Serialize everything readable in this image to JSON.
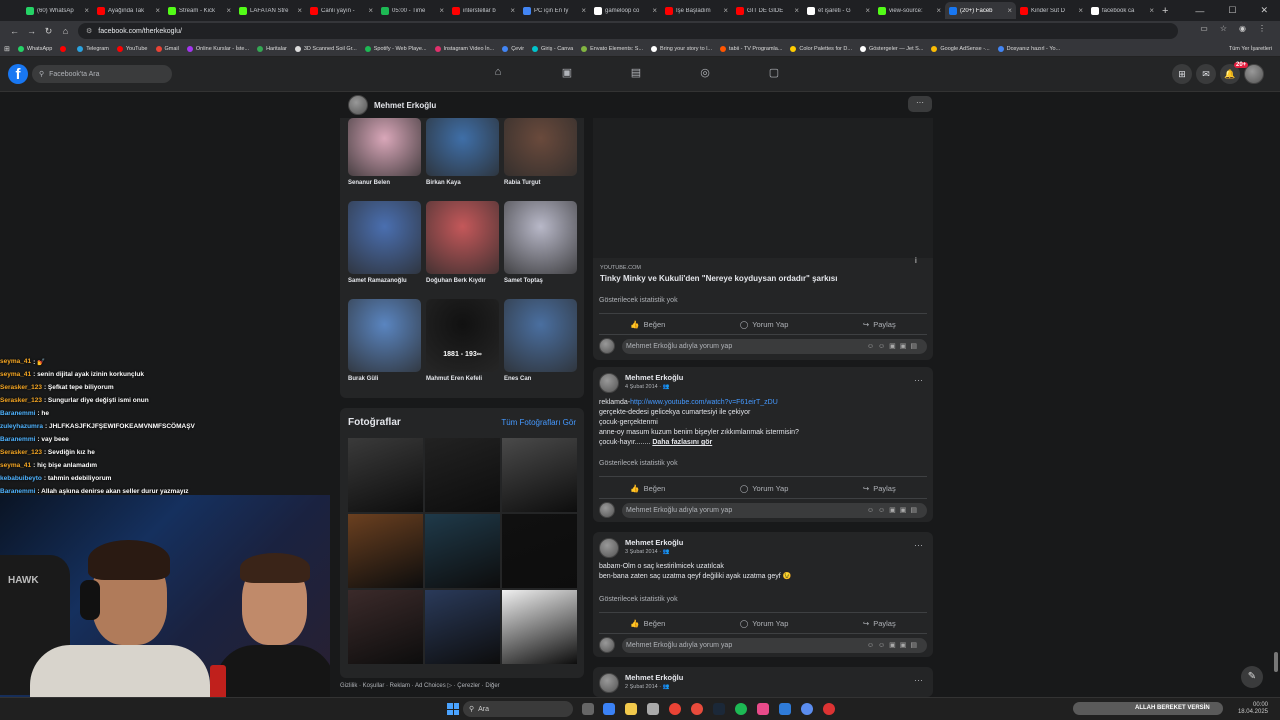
{
  "browser": {
    "tabs": [
      {
        "title": "(60) WhatsAp",
        "color": "#25d366"
      },
      {
        "title": "Ayağında Tak",
        "color": "#ff0000"
      },
      {
        "title": "Stream - Kick",
        "color": "#53fc18"
      },
      {
        "title": "LAFATAN Stre",
        "color": "#53fc18"
      },
      {
        "title": "Canlı yayın -",
        "color": "#ff0000"
      },
      {
        "title": "05:00 - Time",
        "color": "#1db954"
      },
      {
        "title": "interstellar b",
        "color": "#ff0000"
      },
      {
        "title": "PC için En İy",
        "color": "#4285f4"
      },
      {
        "title": "gameloop co",
        "color": "#ffffff"
      },
      {
        "title": "İşe Başladım",
        "color": "#ff0000"
      },
      {
        "title": "GİT DE GİDE",
        "color": "#ff0000"
      },
      {
        "title": "et işareti - G",
        "color": "#ffffff"
      },
      {
        "title": "view-source:",
        "color": "#53fc18"
      },
      {
        "title": "(20+) Faceb",
        "color": "#1877f2",
        "active": true
      },
      {
        "title": "Kinder Süt D",
        "color": "#ff0000"
      },
      {
        "title": "facebook ca",
        "color": "#ffffff"
      }
    ],
    "url": "facebook.com/therkekoglu/",
    "bookmarks": [
      {
        "label": "WhatsApp",
        "color": "#25d366"
      },
      {
        "label": "",
        "color": "#ff0000"
      },
      {
        "label": "Telegram",
        "color": "#2aa3e0"
      },
      {
        "label": "YouTube",
        "color": "#ff0000"
      },
      {
        "label": "Gmail",
        "color": "#ea4335"
      },
      {
        "label": "Online Kurslar - İste...",
        "color": "#a435f0"
      },
      {
        "label": "Haritalar",
        "color": "#34a853"
      },
      {
        "label": "3D Scanned Soil Gr...",
        "color": "#dddddd"
      },
      {
        "label": "Spotify - Web Playe...",
        "color": "#1db954"
      },
      {
        "label": "Instagram Video İn...",
        "color": "#e1306c"
      },
      {
        "label": "Çevir",
        "color": "#4285f4"
      },
      {
        "label": "Giriş - Canva",
        "color": "#00c4cc"
      },
      {
        "label": "Envato Elements: S...",
        "color": "#82b541"
      },
      {
        "label": "Bring your story to l...",
        "color": "#ffffff"
      },
      {
        "label": "tabii - TV Programla...",
        "color": "#ff5500"
      },
      {
        "label": "Color Palettes for D...",
        "color": "#ffcc00"
      },
      {
        "label": "Göstergeler — Jet S...",
        "color": "#ffffff"
      },
      {
        "label": "Google AdSense -...",
        "color": "#fbbc04"
      },
      {
        "label": "Dosyanız hazırl - Yo...",
        "color": "#4285f4"
      }
    ],
    "all_bookmarks": "Tüm Yer İşaretleri"
  },
  "facebook": {
    "search_placeholder": "Facebook'ta Ara",
    "notif_count": "20+",
    "profile_name": "Mehmet Erkoğlu"
  },
  "friends": [
    {
      "name": "Senanur Belen",
      "tone": "#d9a7b9"
    },
    {
      "name": "Birkan Kaya",
      "tone": "#3f6fa8"
    },
    {
      "name": "Rabia Turgut",
      "tone": "#6a4a3c"
    },
    {
      "name": "Samet Ramazanoğlu",
      "tone": "#4a6fb0"
    },
    {
      "name": "Doğuhan Berk Kıydır",
      "tone": "#c4585a"
    },
    {
      "name": "Samet Toptaş",
      "tone": "#b8b8c8"
    },
    {
      "name": "Burak Güli",
      "tone": "#5a85c0"
    },
    {
      "name": "Mahmut Eren Kefeli",
      "tone": "#111111",
      "overlay": "1881 - 193∞"
    },
    {
      "name": "Enes Can",
      "tone": "#4a6fa0"
    }
  ],
  "photos": {
    "title": "Fotoğraflar",
    "see_all": "Tüm Fotoğrafları Gör",
    "tones": [
      "#3a3a3a",
      "#222222",
      "#4a4a4a",
      "#6b4020",
      "#1f3a4a",
      "#101010",
      "#3b2a2a",
      "#2a3a5a",
      "#f0f0f0"
    ]
  },
  "footer": "Gizlilik · Koşullar · Reklam · Ad Choices ▷ · Çerezler · Diğer",
  "posts": {
    "video": {
      "source": "YOUTUBE.COM",
      "title": "Tinky Minky ve Kukuli'den \"Nereye koyduysan ordadır\" şarkısı",
      "stats": "Gösterilecek istatistik yok"
    },
    "actions": {
      "like": "Beğen",
      "comment": "Yorum Yap",
      "share": "Paylaş"
    },
    "comment_placeholder": "Mehmet Erkoğlu adıyla yorum yap",
    "p1": {
      "author": "Mehmet Erkoğlu",
      "date": "4 Şubat 2014",
      "prefix": "reklamda-",
      "link": "http://www.youtube.com/watch?v=F61eirT_zDU",
      "lines": [
        "gerçekte-dedesi gelicekya cumartesiyi ile çekiyor",
        "çocuk-gerçektenmi",
        "anne-oy masum kuzum benim bişeyler zıkkımlanmak istermisin?"
      ],
      "last": "çocuk-hayır........",
      "more": "Daha fazlasını gör",
      "stats": "Gösterilecek istatistik yok"
    },
    "p2": {
      "author": "Mehmet Erkoğlu",
      "date": "3 Şubat 2014",
      "lines": [
        "babam-Olm o saç kestirilmicek uzatılcak",
        "ben-bana zaten saç uzatma qeyf değiliki ayak uzatma geyf 😉"
      ],
      "stats": "Gösterilecek istatistik yok"
    },
    "p3": {
      "author": "Mehmet Erkoğlu",
      "date": "2 Şubat 2014"
    }
  },
  "chat": [
    {
      "user": "seyma_41",
      "msg": ": 💅",
      "ucolor": "#f5a623"
    },
    {
      "user": "seyma_41",
      "msg": ": senin dijital ayak izinin korkunçluk",
      "ucolor": "#f5a623"
    },
    {
      "user": "Serasker_123",
      "msg": ": Şefkat tepe biliyorum",
      "ucolor": "#f5a623"
    },
    {
      "user": "Serasker_123",
      "msg": ": Sungurlar diye değişti ismi onun",
      "ucolor": "#f5a623"
    },
    {
      "user": "Baranemmi",
      "msg": ": he",
      "ucolor": "#4fb3ff"
    },
    {
      "user": "zuleyhazumra",
      "msg": ": JHLFKASJFKJFŞEWIFOKEAMVNMFSCÖMAŞV",
      "ucolor": "#4fb3ff"
    },
    {
      "user": "Baranemmi",
      "msg": ": vay beee",
      "ucolor": "#4fb3ff"
    },
    {
      "user": "Serasker_123",
      "msg": ": Sevdiğin kız he",
      "ucolor": "#f5a623"
    },
    {
      "user": "seyma_41",
      "msg": ": hiç bişe anlamadım",
      "ucolor": "#f5a623"
    },
    {
      "user": "kebabuibeyto",
      "msg": ": tahmin edebiliyorum",
      "ucolor": "#4fb3ff"
    },
    {
      "user": "Baranemmi",
      "msg": ": Allah aşkına denirse akan seller durur yazmayız",
      "ucolor": "#4fb3ff"
    }
  ],
  "taskbar": {
    "search": "Ara",
    "ticker": "ALLAH BEREKET VERSİN",
    "time": "00:00",
    "date": "18.04.2025"
  }
}
